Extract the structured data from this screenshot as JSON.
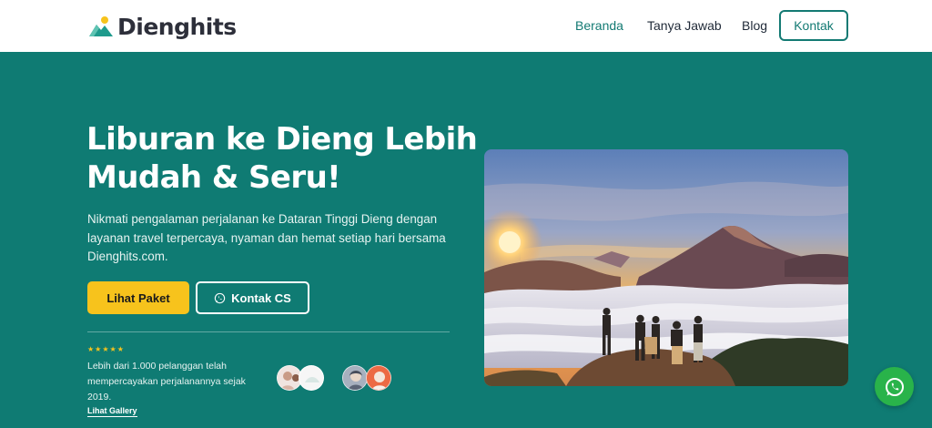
{
  "brand": {
    "name": "Dienghits"
  },
  "nav": {
    "items": [
      {
        "label": "Beranda",
        "active": true
      },
      {
        "label": "Tanya Jawab",
        "active": false
      },
      {
        "label": "Blog",
        "active": false
      }
    ],
    "cta_label": "Kontak"
  },
  "hero": {
    "title": "Liburan ke Dieng Lebih Mudah & Seru!",
    "description": "Nikmati pengalaman perjalanan ke Dataran Tinggi Dieng dengan layanan travel terpercaya, nyaman dan hemat setiap hari bersama Dienghits.com.",
    "primary_button": "Lihat Paket",
    "secondary_button": "Kontak CS",
    "rating": {
      "stars": "★★★★★",
      "value": 5
    },
    "trust_text": "Lebih dari 1.000 pelanggan telah mempercayakan perjalanannya sejak 2019.",
    "gallery_link": "Lihat Gallery"
  },
  "colors": {
    "primary": "#0f7b73",
    "accent": "#f7c31c",
    "whatsapp": "#29b34a"
  },
  "icons": {
    "logo": "mountain-logo-icon",
    "whatsapp": "whatsapp-icon"
  }
}
